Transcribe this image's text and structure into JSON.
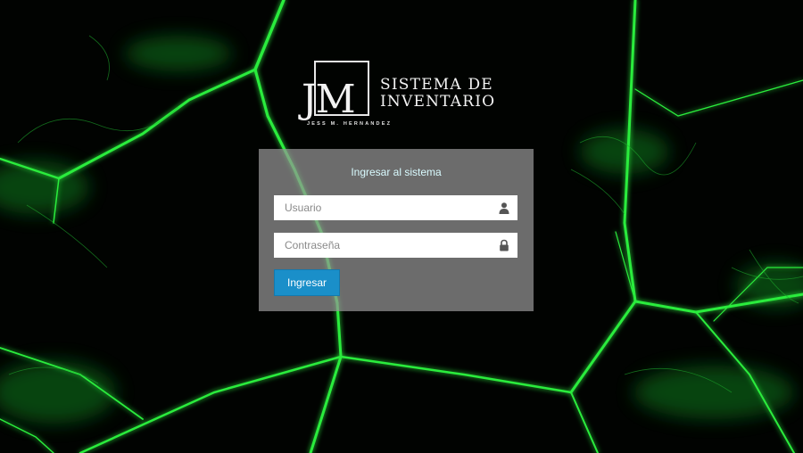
{
  "logo": {
    "monogram": "JM",
    "title": "SISTEMA DE\nINVENTARIO",
    "subtitle": "JESS M. HERNANDEZ"
  },
  "login": {
    "title": "Ingresar al sistema",
    "username_placeholder": "Usuario",
    "username_value": "",
    "password_placeholder": "Contraseña",
    "password_value": "",
    "submit_label": "Ingresar"
  },
  "icons": {
    "username": "user-icon",
    "password": "lock-icon"
  },
  "colors": {
    "background": "#000000",
    "neon_accent": "#27e83a",
    "panel": "#969696",
    "button": "#1a8fc9",
    "panel_title": "#d9fbff"
  }
}
